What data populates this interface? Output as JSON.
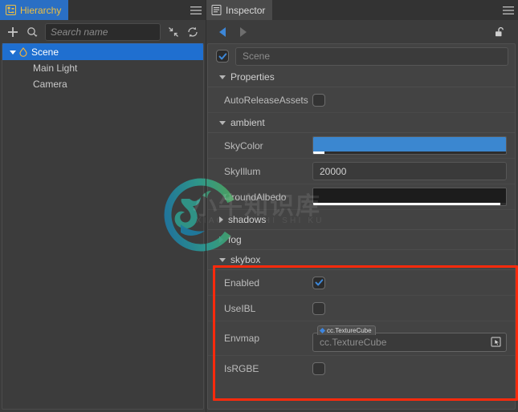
{
  "hierarchy": {
    "tab": {
      "label": "Hierarchy",
      "icon": "hierarchy-icon"
    },
    "menu_icon": "hamburger-icon",
    "toolbar": {
      "add_label": "+",
      "add_icon": "plus-icon",
      "filter_icon": "search-filter-icon",
      "collapse_icon": "collapse-all-icon",
      "refresh_icon": "refresh-icon"
    },
    "search": {
      "placeholder": "Search name",
      "value": ""
    },
    "tree": [
      {
        "label": "Scene",
        "depth": 0,
        "expanded": true,
        "selected": true,
        "icon": "scene-icon"
      },
      {
        "label": "Main Light",
        "depth": 1,
        "expanded": false,
        "selected": false,
        "icon": "none"
      },
      {
        "label": "Camera",
        "depth": 1,
        "expanded": false,
        "selected": false,
        "icon": "none"
      }
    ]
  },
  "inspector": {
    "tab": {
      "label": "Inspector",
      "icon": "inspector-icon"
    },
    "menu_icon": "hamburger-icon",
    "nav": {
      "back_icon": "arrow-left-icon",
      "forward_icon": "arrow-right-icon",
      "lock_icon": "unlock-icon"
    },
    "node": {
      "enabled": true,
      "name_placeholder": "Scene"
    },
    "sections": {
      "properties": {
        "label": "Properties",
        "expanded": true,
        "rows": [
          {
            "label": "AutoReleaseAssets",
            "type": "checkbox",
            "checked": false
          }
        ]
      },
      "ambient": {
        "label": "ambient",
        "expanded": true,
        "rows": [
          {
            "label": "SkyColor",
            "type": "color",
            "color": "#3b87d0",
            "alpha_color": "#ffffff",
            "alpha_width": "6%"
          },
          {
            "label": "SkyIllum",
            "type": "number",
            "value": "20000"
          },
          {
            "label": "GroundAlbedo",
            "type": "color",
            "color": "#1c1c1c",
            "alpha_color": "#ffffff",
            "alpha_width": "97%"
          }
        ]
      },
      "shadows": {
        "label": "shadows",
        "expanded": false
      },
      "fog": {
        "label": "fog",
        "expanded": false
      },
      "skybox": {
        "label": "skybox",
        "expanded": true,
        "highlighted": true,
        "highlight_color": "#fd2a0c",
        "rows": [
          {
            "label": "Enabled",
            "type": "checkbox",
            "checked": true
          },
          {
            "label": "UseIBL",
            "type": "checkbox",
            "checked": false
          },
          {
            "label": "Envmap",
            "type": "asset",
            "badge": "cc.TextureCube",
            "placeholder": "cc.TextureCube",
            "value": "",
            "pick_icon": "asset-picker-icon"
          },
          {
            "label": "IsRGBE",
            "type": "checkbox",
            "checked": false
          }
        ]
      }
    }
  },
  "watermark": {
    "text": "小牛知识库",
    "subtext": "XIAO NIU ZHI SHI KU",
    "logo_icon": "ox-ring-logo-icon"
  }
}
